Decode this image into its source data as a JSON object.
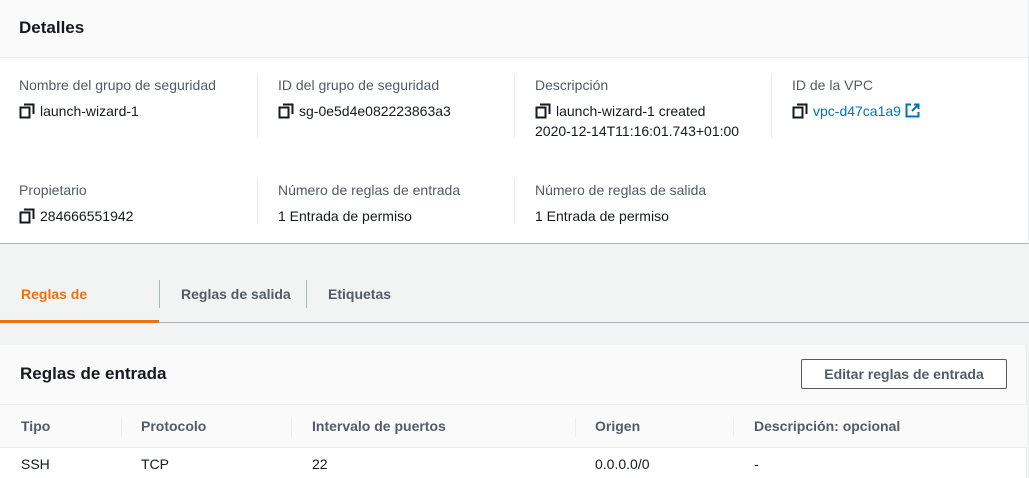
{
  "details": {
    "title": "Detalles",
    "security_group_name": {
      "label": "Nombre del grupo de seguridad",
      "value": "launch-wizard-1"
    },
    "security_group_id": {
      "label": "ID del grupo de seguridad",
      "value": "sg-0e5d4e082223863a3"
    },
    "description": {
      "label": "Descripción",
      "value_line1": "launch-wizard-1 created",
      "value_line2": "2020-12-14T11:16:01.743+01:00"
    },
    "vpc_id": {
      "label": "ID de la VPC",
      "value": "vpc-d47ca1a9"
    },
    "owner": {
      "label": "Propietario",
      "value": "284666551942"
    },
    "inbound_count": {
      "label": "Número de reglas de entrada",
      "value": "1 Entrada de permiso"
    },
    "outbound_count": {
      "label": "Número de reglas de salida",
      "value": "1 Entrada de permiso"
    }
  },
  "tabs": [
    {
      "label": "Reglas de entrada",
      "active": true
    },
    {
      "label": "Reglas de salida",
      "active": false
    },
    {
      "label": "Etiquetas",
      "active": false
    }
  ],
  "rules": {
    "title": "Reglas de entrada",
    "edit_button": "Editar reglas de entrada",
    "columns": [
      "Tipo",
      "Protocolo",
      "Intervalo de puertos",
      "Origen",
      "Descripción: opcional"
    ],
    "rows": [
      [
        "SSH",
        "TCP",
        "22",
        "0.0.0.0/0",
        "-"
      ]
    ]
  },
  "colors": {
    "accent": "#ec7211",
    "link": "#0073bb"
  }
}
